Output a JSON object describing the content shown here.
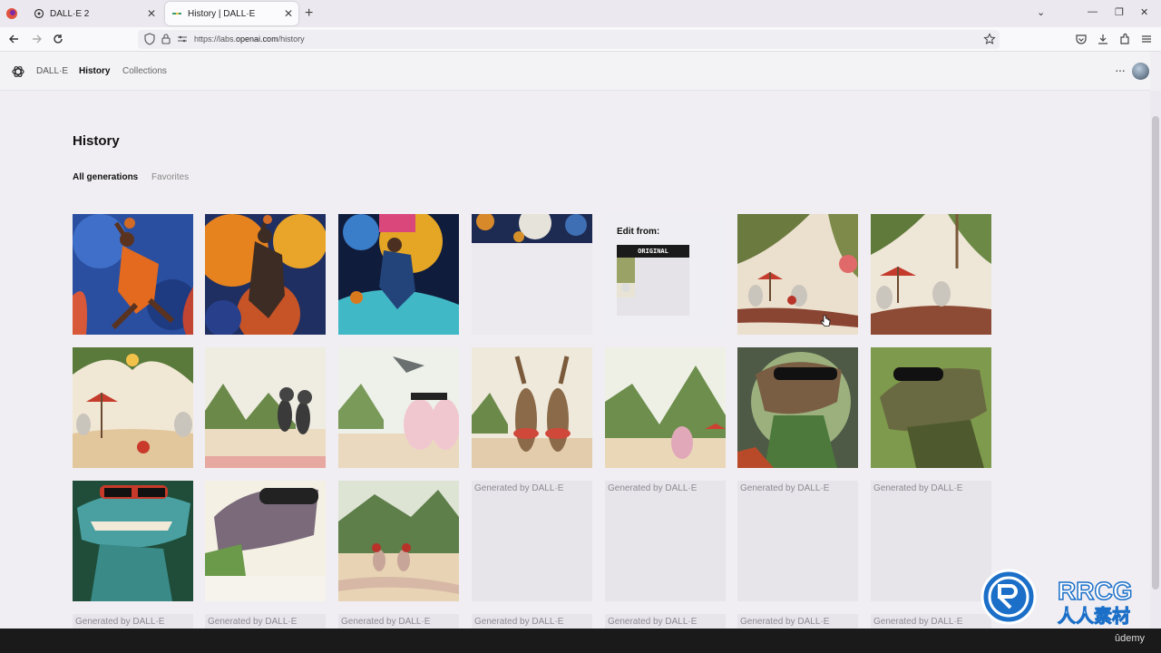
{
  "browser": {
    "tabs": [
      {
        "title": "DALL·E 2",
        "active": false
      },
      {
        "title": "History | DALL·E",
        "active": true
      }
    ],
    "url_prefix": "https://labs.",
    "url_domain": "openai.com",
    "url_path": "/history"
  },
  "app": {
    "brand": "DALL·E",
    "nav": [
      "History",
      "Collections"
    ],
    "more_label": "···"
  },
  "page": {
    "title": "History",
    "tabs": [
      "All generations",
      "Favorites"
    ],
    "edit_from": {
      "label": "Edit from:",
      "badge": "ORIGINAL"
    },
    "placeholder_label": "Generated by DALL·E"
  },
  "grid": {
    "row1": [
      "dunk-red",
      "dunk-orange",
      "dunk-blue",
      "generating",
      "edit-from",
      "mice-beach-1",
      "mice-beach-2"
    ],
    "row2": [
      "mice-beach-3",
      "ants-beach",
      "pigs-beach",
      "kangaroos-beach",
      "beach-mountains",
      "dino-sunglasses-1",
      "dino-sunglasses-2"
    ],
    "row3": [
      "dino-sunglasses-3",
      "dino-sunglasses-4",
      "mice-tropical",
      "placeholder",
      "placeholder",
      "placeholder",
      "placeholder"
    ],
    "row4_labels": [
      "Generated by DALL·E",
      "Generated by DALL·E",
      "Generated by DALL·E",
      "Generated by DALL·E",
      "Generated by DALL·E",
      "Generated by DALL·E",
      "Generated by DALL·E"
    ]
  },
  "watermark": {
    "brand": "RRCG",
    "sub": "人人素材"
  },
  "footer": {
    "label": "ûdemy"
  }
}
